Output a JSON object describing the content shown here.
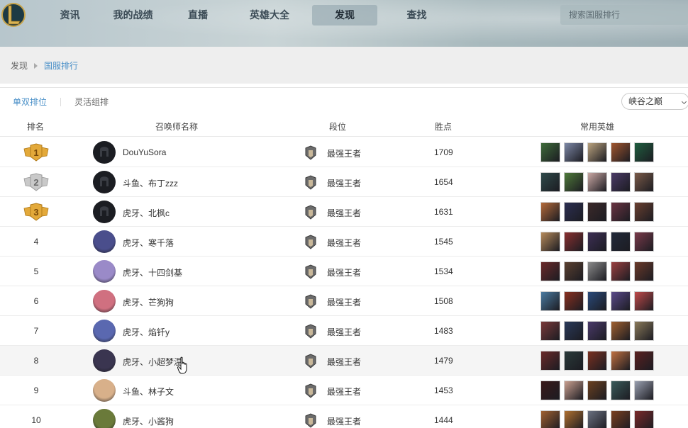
{
  "nav": {
    "items": [
      {
        "label": "资讯",
        "active": false
      },
      {
        "label": "我的战绩",
        "active": false
      },
      {
        "label": "直播",
        "active": false
      },
      {
        "label": "英雄大全",
        "active": false
      },
      {
        "label": "发现",
        "active": true
      },
      {
        "label": "查找",
        "active": false
      }
    ],
    "search_placeholder": "搜索国服排行"
  },
  "breadcrumb": {
    "root": "发现",
    "current": "国服排行"
  },
  "subtabs": {
    "solo": "单双排位",
    "flex": "灵活组排"
  },
  "map_select": {
    "value": "峡谷之巅"
  },
  "table": {
    "headers": {
      "rank": "排名",
      "name": "召唤师名称",
      "tier": "段位",
      "points": "胜点",
      "champs": "常用英雄"
    },
    "rows": [
      {
        "rank": "1",
        "name": "DouYuSora",
        "tier": "最强王者",
        "points": "1709",
        "medal": "gold",
        "avatar": "#1b1d22",
        "champs": [
          "#3e6b3a",
          "#7d88a6",
          "#b9a27e",
          "#a0552e",
          "#1f5e3f"
        ]
      },
      {
        "rank": "2",
        "name": "斗鱼、布丁zzz",
        "tier": "最强王者",
        "points": "1654",
        "medal": "silver",
        "avatar": "#1b1d22",
        "champs": [
          "#2f4a4a",
          "#4f7a3a",
          "#caa8a4",
          "#4a3a66",
          "#7a5a48"
        ]
      },
      {
        "rank": "3",
        "name": "虎牙、北枫c",
        "tier": "最强王者",
        "points": "1631",
        "medal": "gold",
        "avatar": "#1b1d22",
        "champs": [
          "#b46a3a",
          "#2c2f52",
          "#3c2a2a",
          "#6a3442",
          "#6a4030"
        ]
      },
      {
        "rank": "4",
        "name": "虎牙、寒千落",
        "tier": "最强王者",
        "points": "1545",
        "medal": "",
        "avatar": "#4a4e8c",
        "champs": [
          "#b58a5a",
          "#8a3030",
          "#3d2f55",
          "#222a3a",
          "#7a3a4a"
        ]
      },
      {
        "rank": "5",
        "name": "虎牙、十四剑基",
        "tier": "最强王者",
        "points": "1534",
        "medal": "",
        "avatar": "#9a8ac8",
        "champs": [
          "#6a2a2a",
          "#5a4030",
          "#8a8a8a",
          "#9a4040",
          "#6a3a2a"
        ]
      },
      {
        "rank": "6",
        "name": "虎牙、芒狗狗",
        "tier": "最强王者",
        "points": "1508",
        "medal": "",
        "avatar": "#d07080",
        "champs": [
          "#4a7aa0",
          "#8a3020",
          "#2a4a7a",
          "#5a4a8a",
          "#c04a4a"
        ]
      },
      {
        "rank": "7",
        "name": "虎牙、焰钎y",
        "tier": "最强王者",
        "points": "1483",
        "medal": "",
        "avatar": "#5a68b0",
        "champs": [
          "#7a3a3a",
          "#2a3a5a",
          "#4a3a6a",
          "#a06030",
          "#8a7a5a"
        ]
      },
      {
        "rank": "8",
        "name": "虎牙、小超梦温",
        "tier": "最强王者",
        "points": "1479",
        "medal": "",
        "avatar": "#3a3550",
        "champs": [
          "#6a2a2a",
          "#2a3a3a",
          "#7a3020",
          "#c07040",
          "#5a2020"
        ]
      },
      {
        "rank": "9",
        "name": "斗鱼、林子文",
        "tier": "最强王者",
        "points": "1453",
        "medal": "",
        "avatar": "#d8b08a",
        "champs": [
          "#3a1a1a",
          "#caa090",
          "#6a4020",
          "#3a5a5a",
          "#9aa0b0"
        ]
      },
      {
        "rank": "10",
        "name": "虎牙、小酱狗",
        "tier": "最强王者",
        "points": "1444",
        "medal": "",
        "avatar": "#6a7a3a",
        "champs": [
          "#a06030",
          "#b07030",
          "#6a7080",
          "#7a4020",
          "#7a2a2a"
        ]
      }
    ]
  }
}
